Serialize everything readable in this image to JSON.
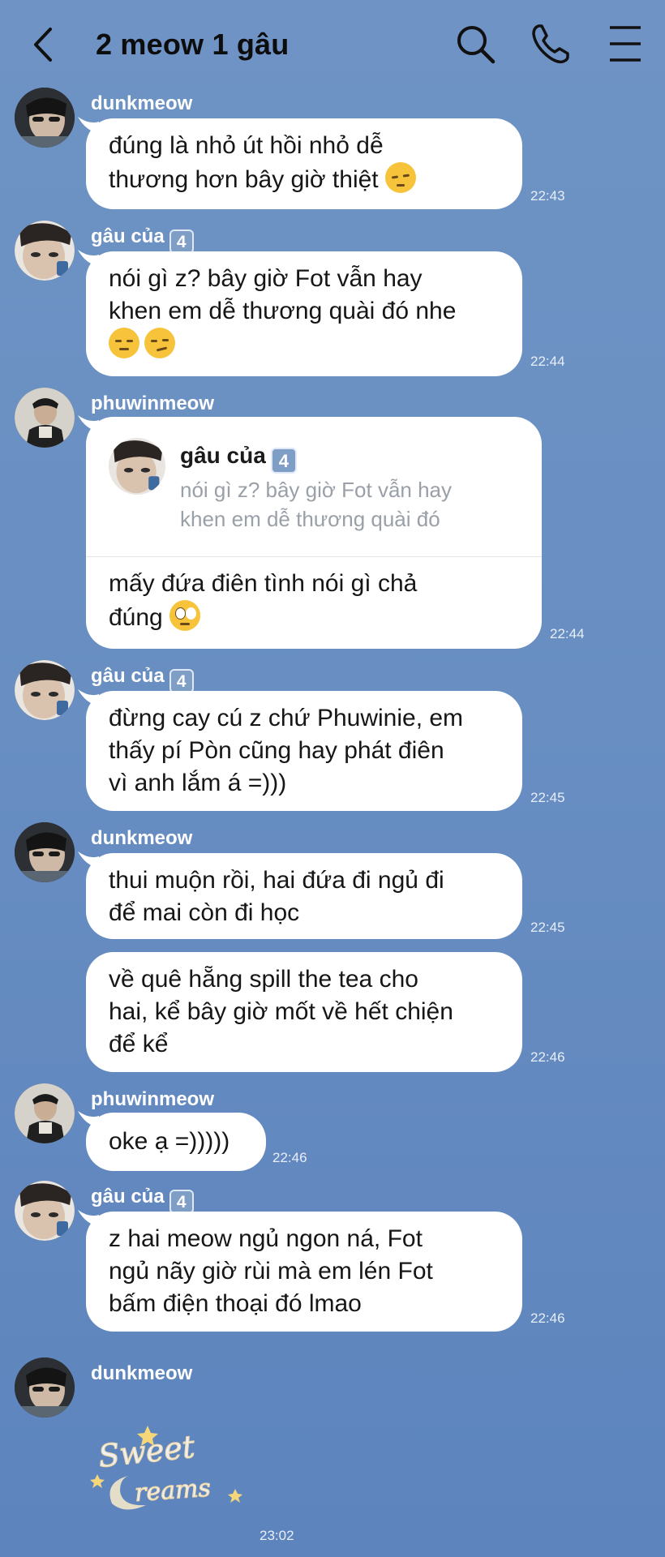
{
  "header": {
    "title": "2 meow 1 gâu",
    "icons": [
      "back-arrow-icon",
      "search-icon",
      "phone-icon",
      "menu-icon"
    ]
  },
  "messages": [
    {
      "sender": "dunkmeow",
      "text_1": "đúng là nhỏ út hồi nhỏ dễ",
      "text_2": "thương hơn bây giờ thiệt",
      "emoji": "pensive",
      "time": "22:43"
    },
    {
      "sender": "gâu của",
      "badge": "4",
      "text_1": "nói gì z? bây giờ Fot vẫn hay",
      "text_2": "khen em dễ thương quài đó nhe",
      "emoji": "relieved smirk",
      "time": "22:44"
    },
    {
      "sender": "phuwinmeow",
      "reply": {
        "name": "gâu của",
        "badge": "4",
        "quote_1": "nói gì z? bây giờ Fot vẫn hay",
        "quote_2": "khen em dễ thương quài đó"
      },
      "text_1": "mấy đứa điên tình nói gì chả",
      "text_2": "đúng",
      "emoji": "face with rolling eyes",
      "time": "22:44"
    },
    {
      "sender": "gâu của",
      "badge": "4",
      "text_1": "đừng cay cú z chứ Phuwinie, em",
      "text_2": "thấy pí Pòn cũng hay phát điên",
      "text_3": "vì anh lắm á =)))",
      "time": "22:45"
    },
    {
      "sender": "dunkmeow",
      "text_1": "thui muộn rồi, hai đứa đi ngủ đi",
      "text_2": "để mai còn đi học",
      "time": "22:45"
    },
    {
      "text_1": "về quê hẵng spill the tea cho",
      "text_2": "hai, kể bây giờ mốt về hết chiện",
      "text_3": "để kể",
      "time": "22:46"
    },
    {
      "sender": "phuwinmeow",
      "text_1": "oke ạ =)))))",
      "time": "22:46"
    },
    {
      "sender": "gâu của",
      "badge": "4",
      "text_1": "z hai meow ngủ ngon ná, Fot",
      "text_2": "ngủ nãy giờ rùi mà em lén Fot",
      "text_3": "bấm điện thoại đó lmao",
      "time": "22:46"
    },
    {
      "sender": "dunkmeow",
      "sticker": "Sweet Dreams",
      "time": "23:02"
    }
  ],
  "colors": {
    "background": "#6a90c3",
    "bubble": "#ffffff",
    "text": "#161616",
    "quote": "#9aa0a8"
  }
}
